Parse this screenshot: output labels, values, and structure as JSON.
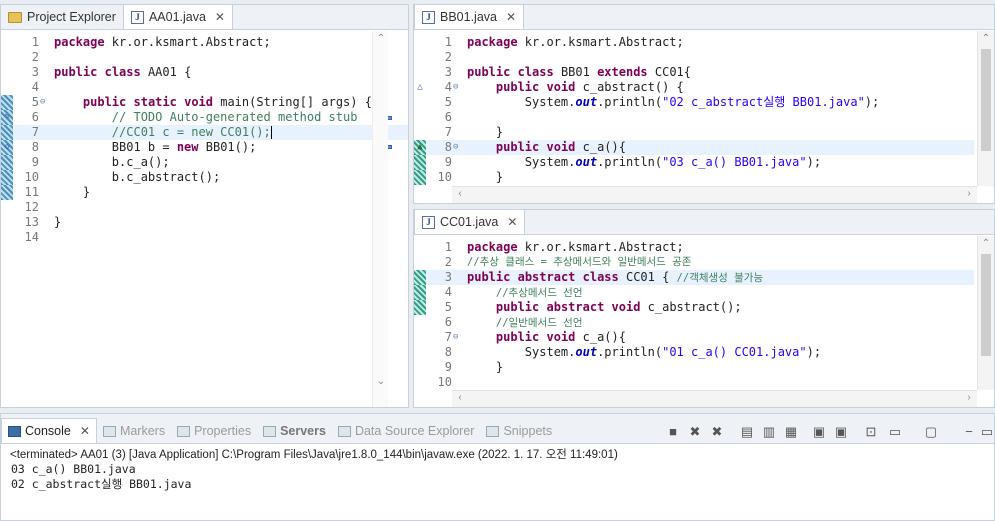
{
  "left": {
    "tabs": [
      {
        "label": "Project Explorer",
        "icon": "folder-icon"
      },
      {
        "label": "AA01.java",
        "icon": "java-file-icon",
        "active": true
      }
    ],
    "lines": [
      [
        "1",
        "package kr.or.ksmart.Abstract;"
      ],
      [
        "2",
        ""
      ],
      [
        "3",
        "public class AA01 {"
      ],
      [
        "4",
        ""
      ],
      [
        "5",
        "    public static void main(String[] args) {"
      ],
      [
        "6",
        "        // TODO Auto-generated method stub"
      ],
      [
        "7",
        "        //CC01 c = new CC01();"
      ],
      [
        "8",
        "        BB01 b = new BB01();"
      ],
      [
        "9",
        "        b.c_a();"
      ],
      [
        "10",
        "        b.c_abstract();"
      ],
      [
        "11",
        "    }"
      ],
      [
        "12",
        ""
      ],
      [
        "13",
        "}"
      ],
      [
        "14",
        ""
      ]
    ]
  },
  "bb": {
    "tab": "BB01.java",
    "lines": [
      [
        "1",
        "package kr.or.ksmart.Abstract;"
      ],
      [
        "2",
        ""
      ],
      [
        "3",
        "public class BB01 extends CC01{"
      ],
      [
        "4",
        "    public void c_abstract() {"
      ],
      [
        "5",
        "        System.out.println(\"02 c_abstract실행 BB01.java\");"
      ],
      [
        "6",
        ""
      ],
      [
        "7",
        "    }"
      ],
      [
        "8",
        "    public void c_a(){"
      ],
      [
        "9",
        "        System.out.println(\"03 c_a() BB01.java\");"
      ],
      [
        "10",
        "    }"
      ]
    ]
  },
  "cc": {
    "tab": "CC01.java",
    "lines": [
      [
        "1",
        "package kr.or.ksmart.Abstract;"
      ],
      [
        "2",
        "//추상 클래스 = 추상메서드와 일반메서드 공존"
      ],
      [
        "3",
        "public abstract class CC01 { //객체생성 불가능"
      ],
      [
        "4",
        "    //추상메서드 선언"
      ],
      [
        "5",
        "    public abstract void c_abstract();"
      ],
      [
        "6",
        "    //일반메서드 선언"
      ],
      [
        "7",
        "    public void c_a(){"
      ],
      [
        "8",
        "        System.out.println(\"01 c_a() CC01.java\");"
      ],
      [
        "9",
        "    }"
      ],
      [
        "10",
        ""
      ]
    ]
  },
  "console": {
    "tabs": [
      {
        "label": "Console",
        "active": true
      },
      {
        "label": "Markers"
      },
      {
        "label": "Properties"
      },
      {
        "label": "Servers",
        "bold": true
      },
      {
        "label": "Data Source Explorer"
      },
      {
        "label": "Snippets"
      }
    ],
    "status": "<terminated> AA01 (3) [Java Application] C:\\Program Files\\Java\\jre1.8.0_144\\bin\\javaw.exe (2022. 1. 17. 오전 11:49:01)",
    "output": [
      "03 c_a() BB01.java",
      "02 c_abstract실행 BB01.java"
    ]
  },
  "colors": {
    "keyword": "#7f0055",
    "comment": "#3f7f5f",
    "string": "#2a00ff",
    "static_field": "#0000c0"
  }
}
